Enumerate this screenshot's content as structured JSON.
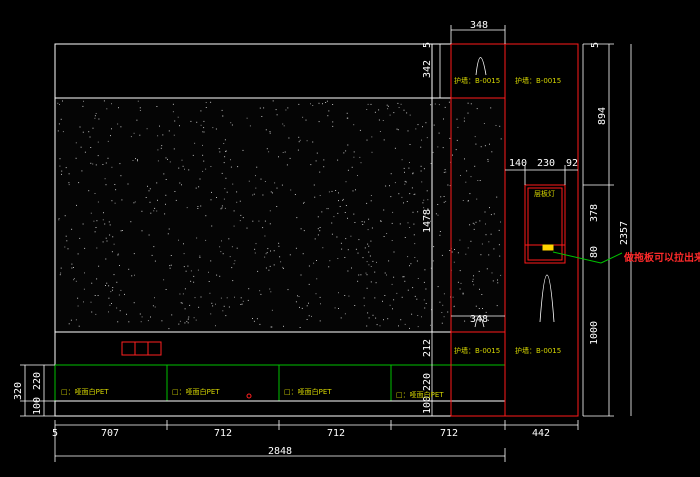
{
  "dimensions": {
    "top_348": "348",
    "bottom_348": "348",
    "top_5": "5",
    "right_5": "5",
    "left_342": "342",
    "right_894": "894",
    "total_2357": "2357",
    "w_140": "140",
    "w_230": "230",
    "w_92": "92",
    "h_378": "378",
    "h_80": "80",
    "h_1000": "1000",
    "h_1478": "1478",
    "h_212": "212",
    "h_220_inner": "220",
    "h_100_inner": "100",
    "left_320": "320",
    "left_220": "220",
    "left_100": "100",
    "b_5": "5",
    "b_707": "707",
    "b_712a": "712",
    "b_712b": "712",
    "b_712c": "712",
    "b_442": "442",
    "total_2848": "2848"
  },
  "labels": {
    "huqiang_1": "护墙：B-0015",
    "huqiang_2": "护墙：B-0015",
    "huqiang_3": "护墙：B-0015",
    "huqiang_4": "护墙：B-0015",
    "shelf_label": "层板灯",
    "drawer_1": "□：哑面白PET",
    "drawer_2": "□：哑面白PET",
    "drawer_3": "□：哑面白PET",
    "drawer_4": "□：哑面白PET"
  },
  "annotation": "做拖板可以拉出来",
  "colors": {
    "background": "#000000",
    "line_white": "#ffffff",
    "line_red": "#ff1a1a",
    "line_green": "#00c000",
    "label_yellow": "#d6d600"
  }
}
